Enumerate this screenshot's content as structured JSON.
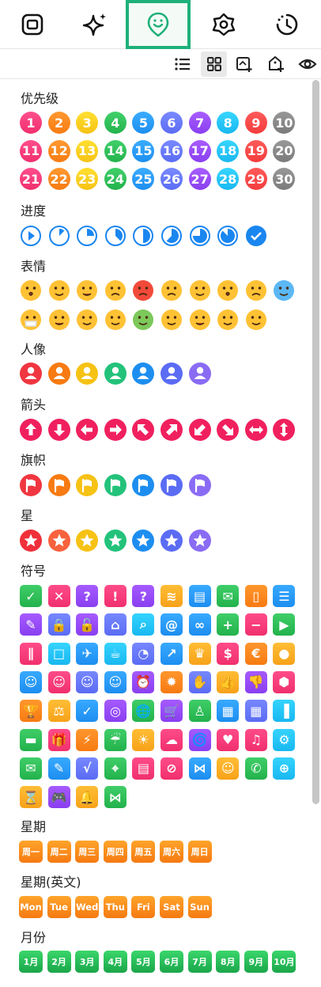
{
  "tabs": [
    {
      "icon": "square-icon",
      "active": false
    },
    {
      "icon": "sparkle-icon",
      "active": false
    },
    {
      "icon": "sticker-icon",
      "active": true
    },
    {
      "icon": "flower-icon",
      "active": false
    },
    {
      "icon": "history-icon",
      "active": false
    }
  ],
  "toolbar": [
    {
      "icon": "list-view-icon",
      "active": false
    },
    {
      "icon": "grid-view-icon",
      "active": true
    },
    {
      "icon": "add-image-icon",
      "active": false
    },
    {
      "icon": "add-tag-icon",
      "active": false
    },
    {
      "icon": "eye-icon",
      "active": false
    }
  ],
  "sections": {
    "priority": {
      "title": "优先级",
      "numbers": [
        "1",
        "2",
        "3",
        "4",
        "5",
        "6",
        "7",
        "8",
        "9",
        "10",
        "11",
        "12",
        "13",
        "14",
        "15",
        "16",
        "17",
        "18",
        "19",
        "20",
        "21",
        "22",
        "23",
        "24",
        "25",
        "26",
        "27",
        "28",
        "29",
        "30"
      ],
      "colors": [
        "#f0306e",
        "#f77b12",
        "#f6c214",
        "#23b24c",
        "#1d8ef0",
        "#5b6cf4",
        "#8a3ff0",
        "#19b8f0",
        "#f43c3c",
        "#7a7a7a"
      ]
    },
    "progress": {
      "title": "进度",
      "levels": [
        0,
        0.125,
        0.25,
        0.375,
        0.5,
        0.625,
        0.75,
        0.875,
        1
      ],
      "color": "#1a86f0"
    },
    "emotion": {
      "title": "表情",
      "count": 19
    },
    "person": {
      "title": "人像",
      "colors": [
        "#f03640",
        "#f77b12",
        "#f6c214",
        "#23c27a",
        "#1d8ef0",
        "#5b6cf4",
        "#8a6cf4"
      ]
    },
    "arrows": {
      "title": "箭头",
      "icons": [
        "arrow-up-icon",
        "arrow-down-icon",
        "arrow-left-icon",
        "arrow-right-icon",
        "arrow-up-left-icon",
        "arrow-up-right-icon",
        "arrow-down-left-icon",
        "arrow-down-right-icon",
        "arrow-left-right-icon",
        "arrow-up-down-icon"
      ],
      "color": "#f0205e"
    },
    "flags": {
      "title": "旗帜",
      "colors": [
        "#f03640",
        "#f77b12",
        "#f6c214",
        "#23c27a",
        "#1d8ef0",
        "#5b6cf4",
        "#8a6cf4"
      ]
    },
    "stars": {
      "title": "星",
      "colors": [
        "#f0303a",
        "#f8623c",
        "#f6c214",
        "#23c27a",
        "#1d8ef0",
        "#5b6cf4",
        "#8a6cf4"
      ]
    },
    "symbols": {
      "title": "符号",
      "rows": [
        [
          {
            "c": "#23b24c",
            "g": "✓"
          },
          {
            "c": "#f0306e",
            "g": "✕"
          },
          {
            "c": "#8a3ff0",
            "g": "?"
          },
          {
            "c": "#f0306e",
            "g": "!"
          },
          {
            "c": "#8a3ff0",
            "g": "?"
          },
          {
            "c": "#f7a21a",
            "g": "≋"
          },
          {
            "c": "#1d8ef0",
            "g": "▤"
          },
          {
            "c": "#23b24c",
            "g": "✉"
          },
          {
            "c": "#f77b12",
            "g": "▯"
          },
          {
            "c": "#1d8ef0",
            "g": "☰"
          }
        ],
        [
          {
            "c": "#8a3ff0",
            "g": "✎"
          },
          {
            "c": "#5b6cf4",
            "g": "🔒"
          },
          {
            "c": "#8a3ff0",
            "g": "🔓"
          },
          {
            "c": "#5b6cf4",
            "g": "⌂"
          },
          {
            "c": "#19b8f0",
            "g": "⌕"
          },
          {
            "c": "#1d8ef0",
            "g": "@"
          },
          {
            "c": "#1d8ef0",
            "g": "∞"
          },
          {
            "c": "#23b24c",
            "g": "+"
          },
          {
            "c": "#f0306e",
            "g": "−"
          },
          {
            "c": "#23b24c",
            "g": "▶"
          }
        ],
        [
          {
            "c": "#f0306e",
            "g": "∥"
          },
          {
            "c": "#19b8f0",
            "g": "□"
          },
          {
            "c": "#1d8ef0",
            "g": "✈"
          },
          {
            "c": "#19b8f0",
            "g": "☕"
          },
          {
            "c": "#5b6cf4",
            "g": "◔"
          },
          {
            "c": "#1d8ef0",
            "g": "↗"
          },
          {
            "c": "#f7a21a",
            "g": "♛"
          },
          {
            "c": "#f0306e",
            "g": "$"
          },
          {
            "c": "#f77b12",
            "g": "€"
          },
          {
            "c": "#f7a21a",
            "g": "●"
          }
        ],
        [
          {
            "c": "#1d8ef0",
            "g": "☺"
          },
          {
            "c": "#f0306e",
            "g": "☺"
          },
          {
            "c": "#5b6cf4",
            "g": "☺"
          },
          {
            "c": "#1d8ef0",
            "g": "☺"
          },
          {
            "c": "#8a3ff0",
            "g": "⏰"
          },
          {
            "c": "#f77b12",
            "g": "✹"
          },
          {
            "c": "#5b6cf4",
            "g": "✋"
          },
          {
            "c": "#f7a21a",
            "g": "👍"
          },
          {
            "c": "#8a3ff0",
            "g": "👎"
          },
          {
            "c": "#f0306e",
            "g": "⬢"
          }
        ],
        [
          {
            "c": "#f77b12",
            "g": "🏆"
          },
          {
            "c": "#f7a21a",
            "g": "⚖"
          },
          {
            "c": "#1d8ef0",
            "g": "✓"
          },
          {
            "c": "#8a3ff0",
            "g": "◎"
          },
          {
            "c": "#23b24c",
            "g": "🌐"
          },
          {
            "c": "#8a3ff0",
            "g": "🛒"
          },
          {
            "c": "#23b24c",
            "g": "♙"
          },
          {
            "c": "#1d8ef0",
            "g": "▦"
          },
          {
            "c": "#5b6cf4",
            "g": "▦"
          },
          {
            "c": "#19b8f0",
            "g": "▐"
          }
        ],
        [
          {
            "c": "#23b24c",
            "g": "▬"
          },
          {
            "c": "#f0306e",
            "g": "🎁"
          },
          {
            "c": "#f77b12",
            "g": "⚡"
          },
          {
            "c": "#23b24c",
            "g": "☔"
          },
          {
            "c": "#f7a21a",
            "g": "☀"
          },
          {
            "c": "#f0306e",
            "g": "☁"
          },
          {
            "c": "#8a3ff0",
            "g": "🌀"
          },
          {
            "c": "#f0306e",
            "g": "♥"
          },
          {
            "c": "#f0306e",
            "g": "♫"
          },
          {
            "c": "#19b8f0",
            "g": "⚙"
          }
        ],
        [
          {
            "c": "#23b24c",
            "g": "✉"
          },
          {
            "c": "#1d8ef0",
            "g": "✎"
          },
          {
            "c": "#5b6cf4",
            "g": "√"
          },
          {
            "c": "#23b24c",
            "g": "⌖"
          },
          {
            "c": "#f0306e",
            "g": "▤"
          },
          {
            "c": "#f0306e",
            "g": "⊘"
          },
          {
            "c": "#1d8ef0",
            "g": "⋈"
          },
          {
            "c": "#f7a21a",
            "g": "☺"
          },
          {
            "c": "#23b24c",
            "g": "✆"
          },
          {
            "c": "#19b8f0",
            "g": "⊕"
          }
        ],
        [
          {
            "c": "#f7a21a",
            "g": "⌛"
          },
          {
            "c": "#8a3ff0",
            "g": "🎮"
          },
          {
            "c": "#f7a21a",
            "g": "🔔"
          },
          {
            "c": "#23b24c",
            "g": "⋈"
          }
        ]
      ]
    },
    "weekday": {
      "title": "星期",
      "labels": [
        "周一",
        "周二",
        "周三",
        "周四",
        "周五",
        "周六",
        "周日"
      ]
    },
    "weekday_en": {
      "title": "星期(英文)",
      "labels": [
        "Mon",
        "Tue",
        "Wed",
        "Thu",
        "Fri",
        "Sat",
        "Sun"
      ]
    },
    "month": {
      "title": "月份",
      "labels": [
        "1月",
        "2月",
        "3月",
        "4月",
        "5月",
        "6月",
        "7月",
        "8月",
        "9月",
        "10月"
      ]
    }
  }
}
